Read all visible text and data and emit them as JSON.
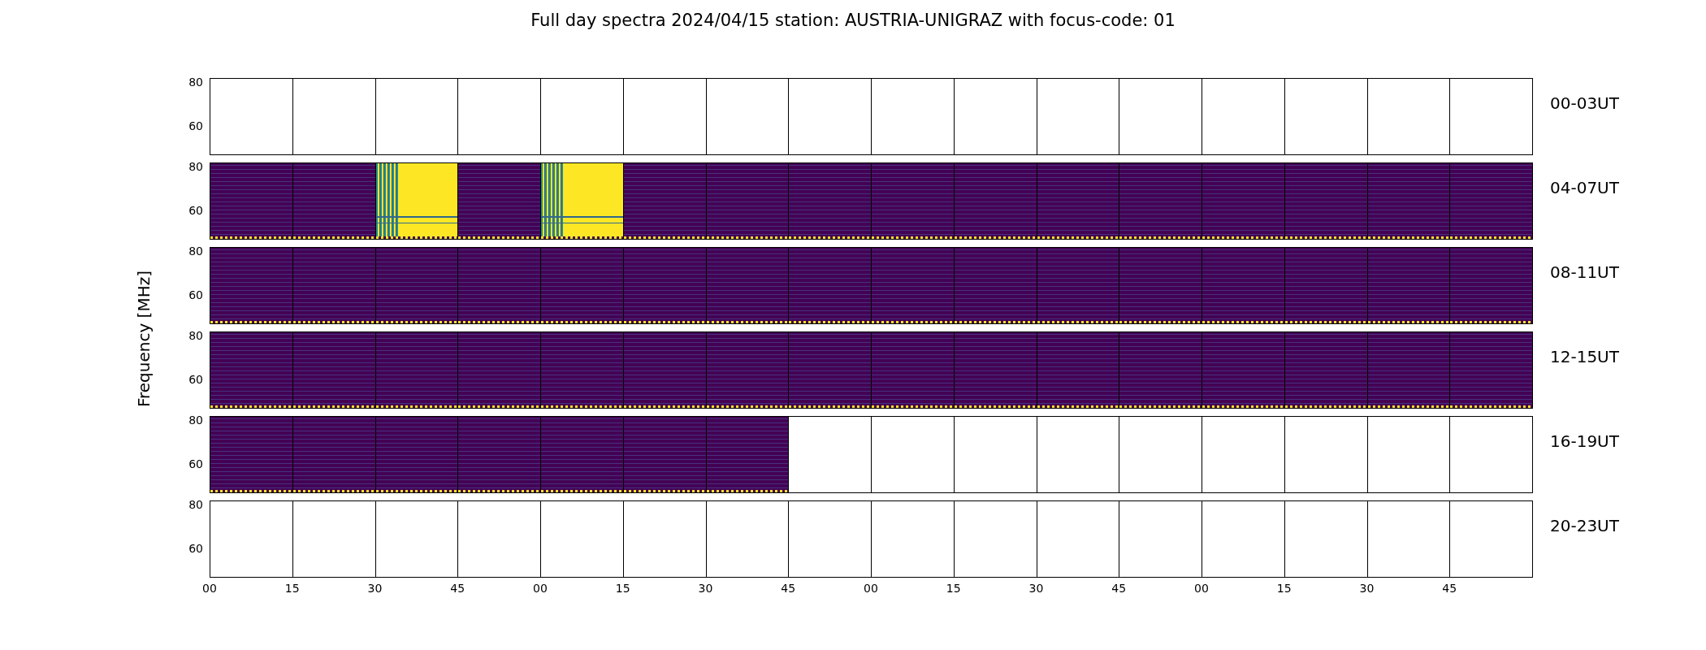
{
  "title": "Full day spectra 2024/04/15 station: AUSTRIA-UNIGRAZ with focus-code: 01",
  "y_axis_label": "Frequency [MHz]",
  "rows": [
    {
      "label": "00-03UT",
      "y_ticks": [
        "80",
        "60"
      ],
      "panels": [
        {
          "kind": "empty"
        },
        {
          "kind": "empty"
        },
        {
          "kind": "empty"
        },
        {
          "kind": "empty"
        },
        {
          "kind": "empty"
        },
        {
          "kind": "empty"
        },
        {
          "kind": "empty"
        },
        {
          "kind": "empty"
        },
        {
          "kind": "empty"
        },
        {
          "kind": "empty"
        },
        {
          "kind": "empty"
        },
        {
          "kind": "empty"
        },
        {
          "kind": "empty"
        },
        {
          "kind": "empty"
        },
        {
          "kind": "empty"
        },
        {
          "kind": "empty"
        }
      ]
    },
    {
      "label": "04-07UT",
      "y_ticks": [
        "80",
        "60"
      ],
      "panels": [
        {
          "kind": "spectrum"
        },
        {
          "kind": "spectrum"
        },
        {
          "kind": "saturated"
        },
        {
          "kind": "spectrum"
        },
        {
          "kind": "saturated"
        },
        {
          "kind": "spectrum"
        },
        {
          "kind": "spectrum"
        },
        {
          "kind": "spectrum"
        },
        {
          "kind": "spectrum"
        },
        {
          "kind": "spectrum"
        },
        {
          "kind": "spectrum"
        },
        {
          "kind": "spectrum"
        },
        {
          "kind": "spectrum"
        },
        {
          "kind": "spectrum"
        },
        {
          "kind": "spectrum"
        },
        {
          "kind": "spectrum"
        }
      ]
    },
    {
      "label": "08-11UT",
      "y_ticks": [
        "80",
        "60"
      ],
      "panels": [
        {
          "kind": "spectrum"
        },
        {
          "kind": "spectrum"
        },
        {
          "kind": "spectrum"
        },
        {
          "kind": "spectrum"
        },
        {
          "kind": "spectrum"
        },
        {
          "kind": "spectrum"
        },
        {
          "kind": "spectrum"
        },
        {
          "kind": "spectrum"
        },
        {
          "kind": "spectrum"
        },
        {
          "kind": "spectrum"
        },
        {
          "kind": "spectrum"
        },
        {
          "kind": "spectrum"
        },
        {
          "kind": "spectrum"
        },
        {
          "kind": "spectrum"
        },
        {
          "kind": "spectrum"
        },
        {
          "kind": "spectrum"
        }
      ]
    },
    {
      "label": "12-15UT",
      "y_ticks": [
        "80",
        "60"
      ],
      "panels": [
        {
          "kind": "spectrum"
        },
        {
          "kind": "spectrum"
        },
        {
          "kind": "spectrum"
        },
        {
          "kind": "spectrum"
        },
        {
          "kind": "spectrum"
        },
        {
          "kind": "spectrum"
        },
        {
          "kind": "spectrum"
        },
        {
          "kind": "spectrum"
        },
        {
          "kind": "spectrum"
        },
        {
          "kind": "spectrum"
        },
        {
          "kind": "spectrum"
        },
        {
          "kind": "spectrum"
        },
        {
          "kind": "spectrum"
        },
        {
          "kind": "spectrum"
        },
        {
          "kind": "spectrum"
        },
        {
          "kind": "spectrum"
        }
      ]
    },
    {
      "label": "16-19UT",
      "y_ticks": [
        "80",
        "60"
      ],
      "panels": [
        {
          "kind": "spectrum"
        },
        {
          "kind": "spectrum"
        },
        {
          "kind": "spectrum"
        },
        {
          "kind": "spectrum"
        },
        {
          "kind": "spectrum"
        },
        {
          "kind": "spectrum"
        },
        {
          "kind": "spectrum"
        },
        {
          "kind": "empty"
        },
        {
          "kind": "empty"
        },
        {
          "kind": "empty"
        },
        {
          "kind": "empty"
        },
        {
          "kind": "empty"
        },
        {
          "kind": "empty"
        },
        {
          "kind": "empty"
        },
        {
          "kind": "empty"
        },
        {
          "kind": "empty"
        }
      ]
    },
    {
      "label": "20-23UT",
      "y_ticks": [
        "80",
        "60"
      ],
      "panels": [
        {
          "kind": "empty"
        },
        {
          "kind": "empty"
        },
        {
          "kind": "empty"
        },
        {
          "kind": "empty"
        },
        {
          "kind": "empty"
        },
        {
          "kind": "empty"
        },
        {
          "kind": "empty"
        },
        {
          "kind": "empty"
        },
        {
          "kind": "empty"
        },
        {
          "kind": "empty"
        },
        {
          "kind": "empty"
        },
        {
          "kind": "empty"
        },
        {
          "kind": "empty"
        },
        {
          "kind": "empty"
        },
        {
          "kind": "empty"
        },
        {
          "kind": "empty"
        }
      ]
    }
  ],
  "x_tick_labels": [
    "00",
    "15",
    "30",
    "45",
    "00",
    "15",
    "30",
    "45",
    "00",
    "15",
    "30",
    "45",
    "00",
    "15",
    "30",
    "45"
  ]
}
